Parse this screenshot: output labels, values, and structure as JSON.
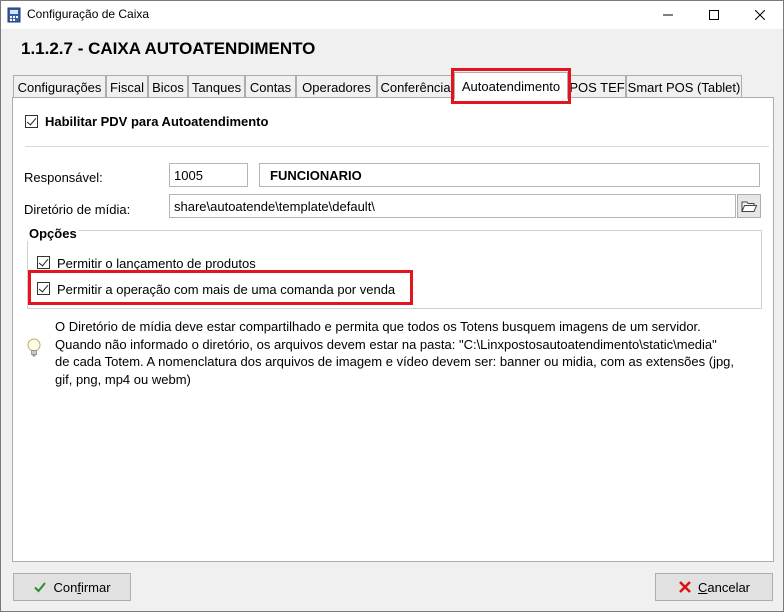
{
  "window": {
    "title": "Configuração de Caixa",
    "minimize_glyph": "—",
    "maximize_glyph": "☐",
    "close_glyph": "✕"
  },
  "heading": "1.1.2.7 - CAIXA AUTOATENDIMENTO",
  "tabs": [
    {
      "label": "Configurações"
    },
    {
      "label": "Fiscal"
    },
    {
      "label": "Bicos"
    },
    {
      "label": "Tanques"
    },
    {
      "label": "Contas"
    },
    {
      "label": "Operadores"
    },
    {
      "label": "Conferência"
    },
    {
      "label": "Autoatendimento",
      "active": true
    },
    {
      "label": "POS TEF"
    },
    {
      "label": "Smart POS (Tablet)"
    }
  ],
  "panel": {
    "enable_checkbox": {
      "label": "Habilitar PDV para Autoatendimento",
      "checked": true
    },
    "responsavel": {
      "label": "Responsável:",
      "code": "1005",
      "name": "FUNCIONARIO"
    },
    "media_dir": {
      "label": "Diretório de mídia:",
      "value": "share\\autoatende\\template\\default\\"
    },
    "options": {
      "title": "Opções",
      "items": [
        {
          "label": "Permitir o lançamento de produtos",
          "checked": true
        },
        {
          "label": "Permitir a operação com mais de uma comanda por venda",
          "checked": true
        }
      ]
    },
    "info": {
      "line1": "O Diretório de mídia deve estar compartilhado e permita que todos os Totens busquem imagens de um servidor.",
      "line2": "Quando não informado o diretório, os arquivos devem estar na pasta: \"C:\\Linxpostosautoatendimento\\static\\media\"",
      "line3": "de cada Totem. A nomenclatura dos arquivos de imagem e vídeo devem ser: banner ou midia, com as extensões (jpg,",
      "line4": "gif, png, mp4 ou webm)"
    }
  },
  "buttons": {
    "confirm_prefix": "Con",
    "confirm_u": "f",
    "confirm_rest": "irmar",
    "cancel_u": "C",
    "cancel_rest": "ancelar"
  },
  "colors": {
    "highlight": "#e3141d",
    "accent_check": "#2e8b2e",
    "cancel_x": "#d11"
  },
  "icons": [
    "app-icon",
    "folder-icon",
    "lightbulb-icon",
    "check-icon",
    "x-icon"
  ]
}
